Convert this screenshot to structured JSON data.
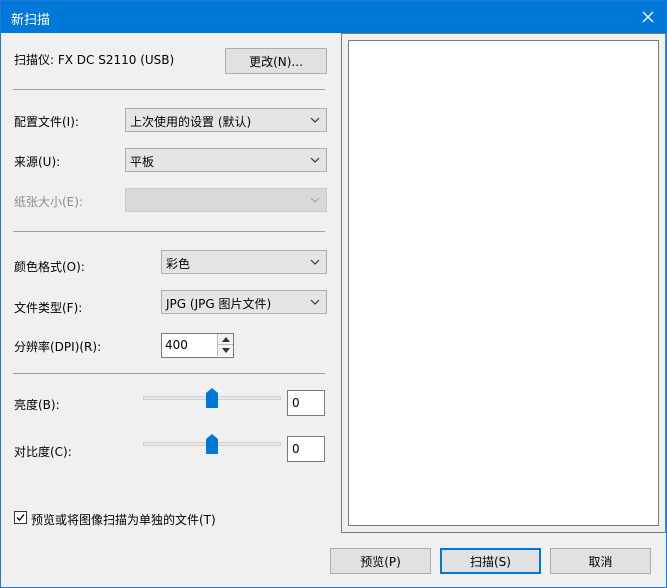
{
  "window": {
    "title": "新扫描"
  },
  "scanner": {
    "label": "扫描仪: FX DC S2110 (USB)",
    "change_button": "更改(N)..."
  },
  "profile": {
    "label": "配置文件(I):",
    "value": "上次使用的设置 (默认)"
  },
  "source": {
    "label": "来源(U):",
    "value": "平板"
  },
  "paper_size": {
    "label": "纸张大小(E):",
    "value": ""
  },
  "color_format": {
    "label": "颜色格式(O):",
    "value": "彩色"
  },
  "file_type": {
    "label": "文件类型(F):",
    "value": "JPG (JPG 图片文件)"
  },
  "resolution": {
    "label": "分辨率(DPI)(R):",
    "value": "400"
  },
  "brightness": {
    "label": "亮度(B):",
    "value": "0"
  },
  "contrast": {
    "label": "对比度(C):",
    "value": "0"
  },
  "separate_files": {
    "label": "预览或将图像扫描为单独的文件(T)",
    "checked": true
  },
  "buttons": {
    "preview": "预览(P)",
    "scan": "扫描(S)",
    "cancel": "取消"
  },
  "colors": {
    "titlebar": "#0078d7",
    "slider_thumb": "#0078d7",
    "dialog_bg": "#f0f0f0"
  },
  "icons": [
    "close-icon",
    "chevron-down-icon",
    "spin-up-icon",
    "spin-down-icon",
    "checkmark-icon"
  ]
}
